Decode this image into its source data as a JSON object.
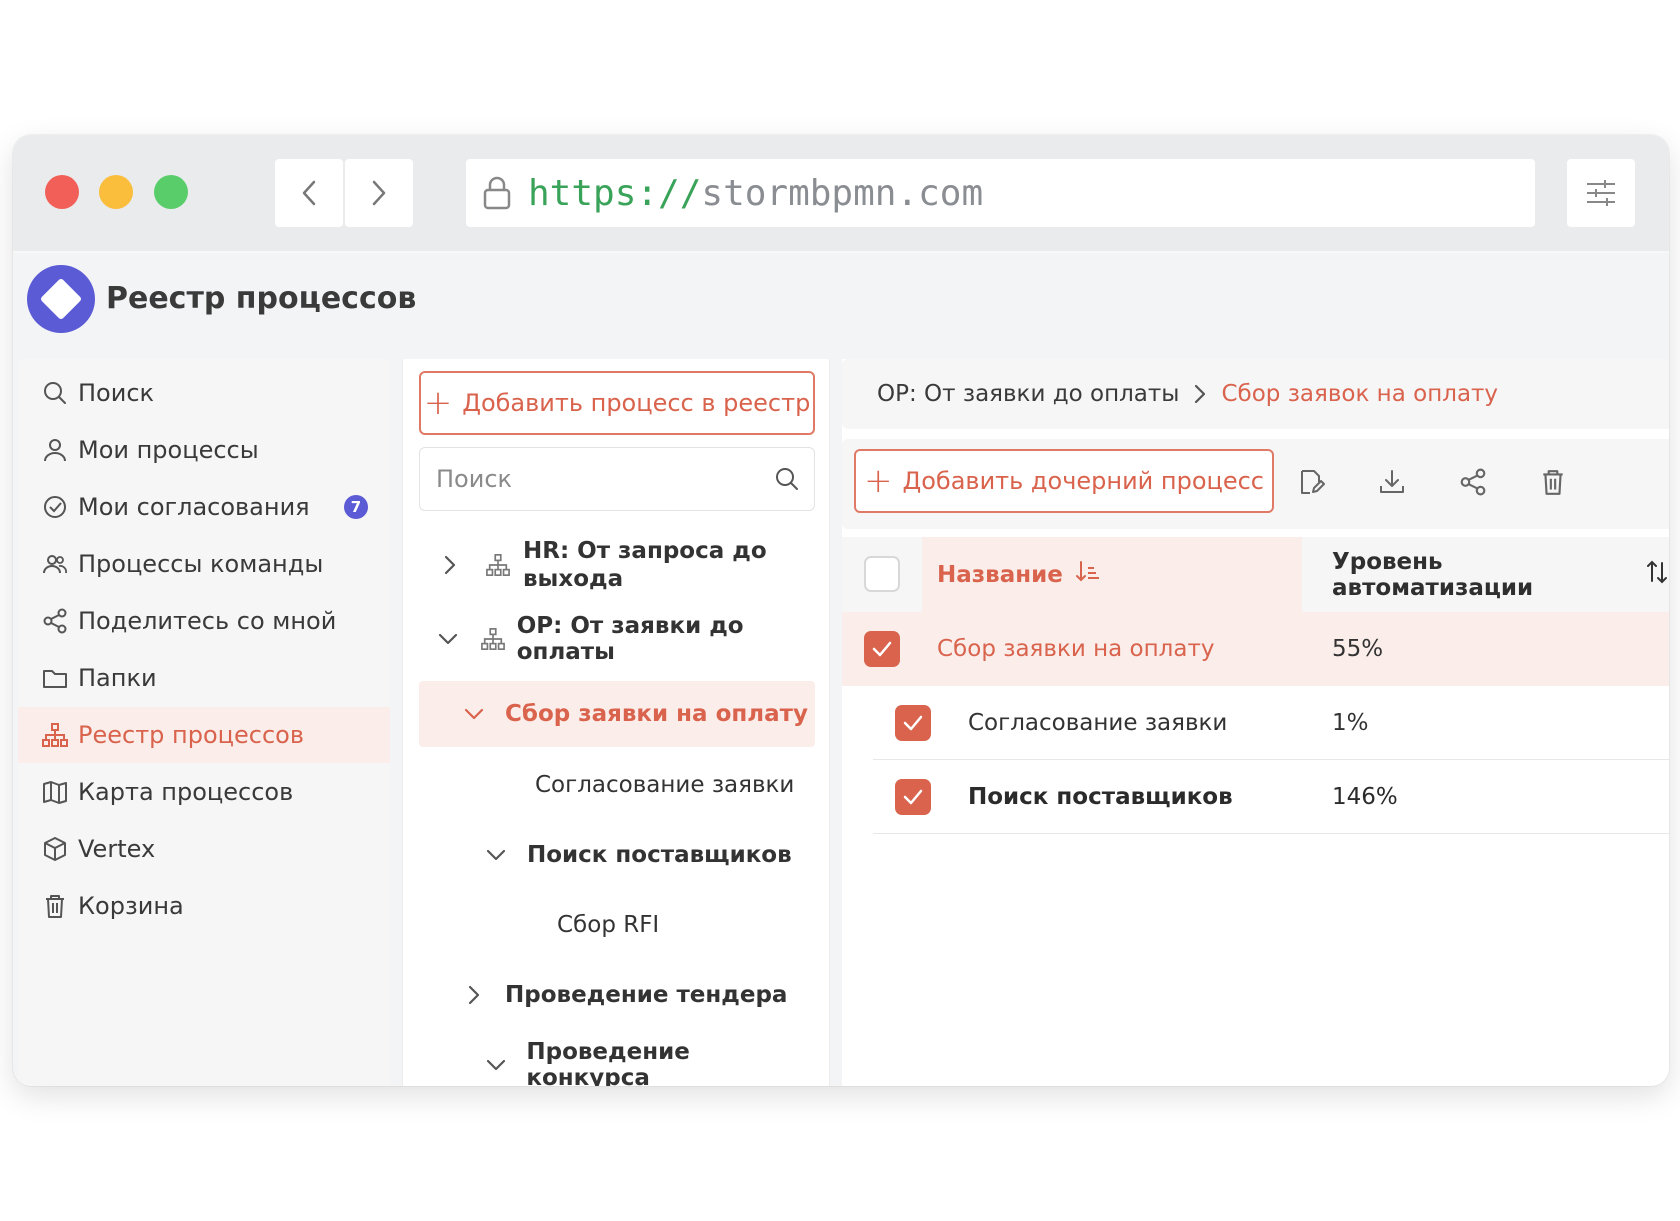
{
  "browser": {
    "url_scheme": "https://",
    "url_host": "stormbpmn.com"
  },
  "app": {
    "title": "Реестр процессов"
  },
  "sidebar": {
    "items": [
      {
        "label": "Поиск",
        "icon": "search-icon"
      },
      {
        "label": "Мои процессы",
        "icon": "user-icon"
      },
      {
        "label": "Мои согласования",
        "icon": "check-circle-icon",
        "badge": "7"
      },
      {
        "label": "Процессы команды",
        "icon": "team-icon"
      },
      {
        "label": "Поделитесь со мной",
        "icon": "share-icon"
      },
      {
        "label": "Папки",
        "icon": "folder-icon"
      },
      {
        "label": "Реестр процессов",
        "icon": "hierarchy-icon",
        "active": true
      },
      {
        "label": "Карта процессов",
        "icon": "map-icon"
      },
      {
        "label": "Vertex",
        "icon": "cube-icon"
      },
      {
        "label": "Корзина",
        "icon": "trash-icon"
      }
    ]
  },
  "registry": {
    "add_button": "Добавить процесс в реестр",
    "search_placeholder": "Поиск",
    "tree": [
      {
        "label": "HR: От запроса до",
        "label2": "выхода",
        "expanded": false,
        "level": 0
      },
      {
        "label": "OP: От заявки до оплаты",
        "expanded": true,
        "level": 0
      },
      {
        "label": "Сбор заявки на оплату",
        "expanded": true,
        "level": 1,
        "selected": true
      },
      {
        "label": "Согласование заявки",
        "level": 2
      },
      {
        "label": "Поиск поставщиков",
        "expanded": true,
        "level": 2
      },
      {
        "label": "Сбор RFI",
        "level": 3
      },
      {
        "label": "Проведение тендера",
        "expanded": false,
        "level": 1
      },
      {
        "label": "Проведение конкурса",
        "expanded": true,
        "level": 2
      }
    ]
  },
  "content": {
    "breadcrumb": [
      "OP: От заявки до оплаты",
      "Сбор заявок на оплату"
    ],
    "add_child_button": "Добавить дочерний процесс",
    "toolbar_icons": [
      "edit-icon",
      "download-icon",
      "share-icon",
      "trash-icon"
    ],
    "table": {
      "headers": {
        "name": "Название",
        "automation": "Уровень автоматизации"
      },
      "rows": [
        {
          "name": "Сбор заявки на оплату",
          "automation": "55%",
          "checked": true
        },
        {
          "name": "Согласование заявки",
          "automation": "1%",
          "checked": true
        },
        {
          "name": "Поиск поставщиков",
          "automation": "146%",
          "checked": true
        }
      ]
    }
  },
  "colors": {
    "accent": "#d9634d",
    "accent_bg": "#fbeeea",
    "brand": "#5b5bd6"
  }
}
